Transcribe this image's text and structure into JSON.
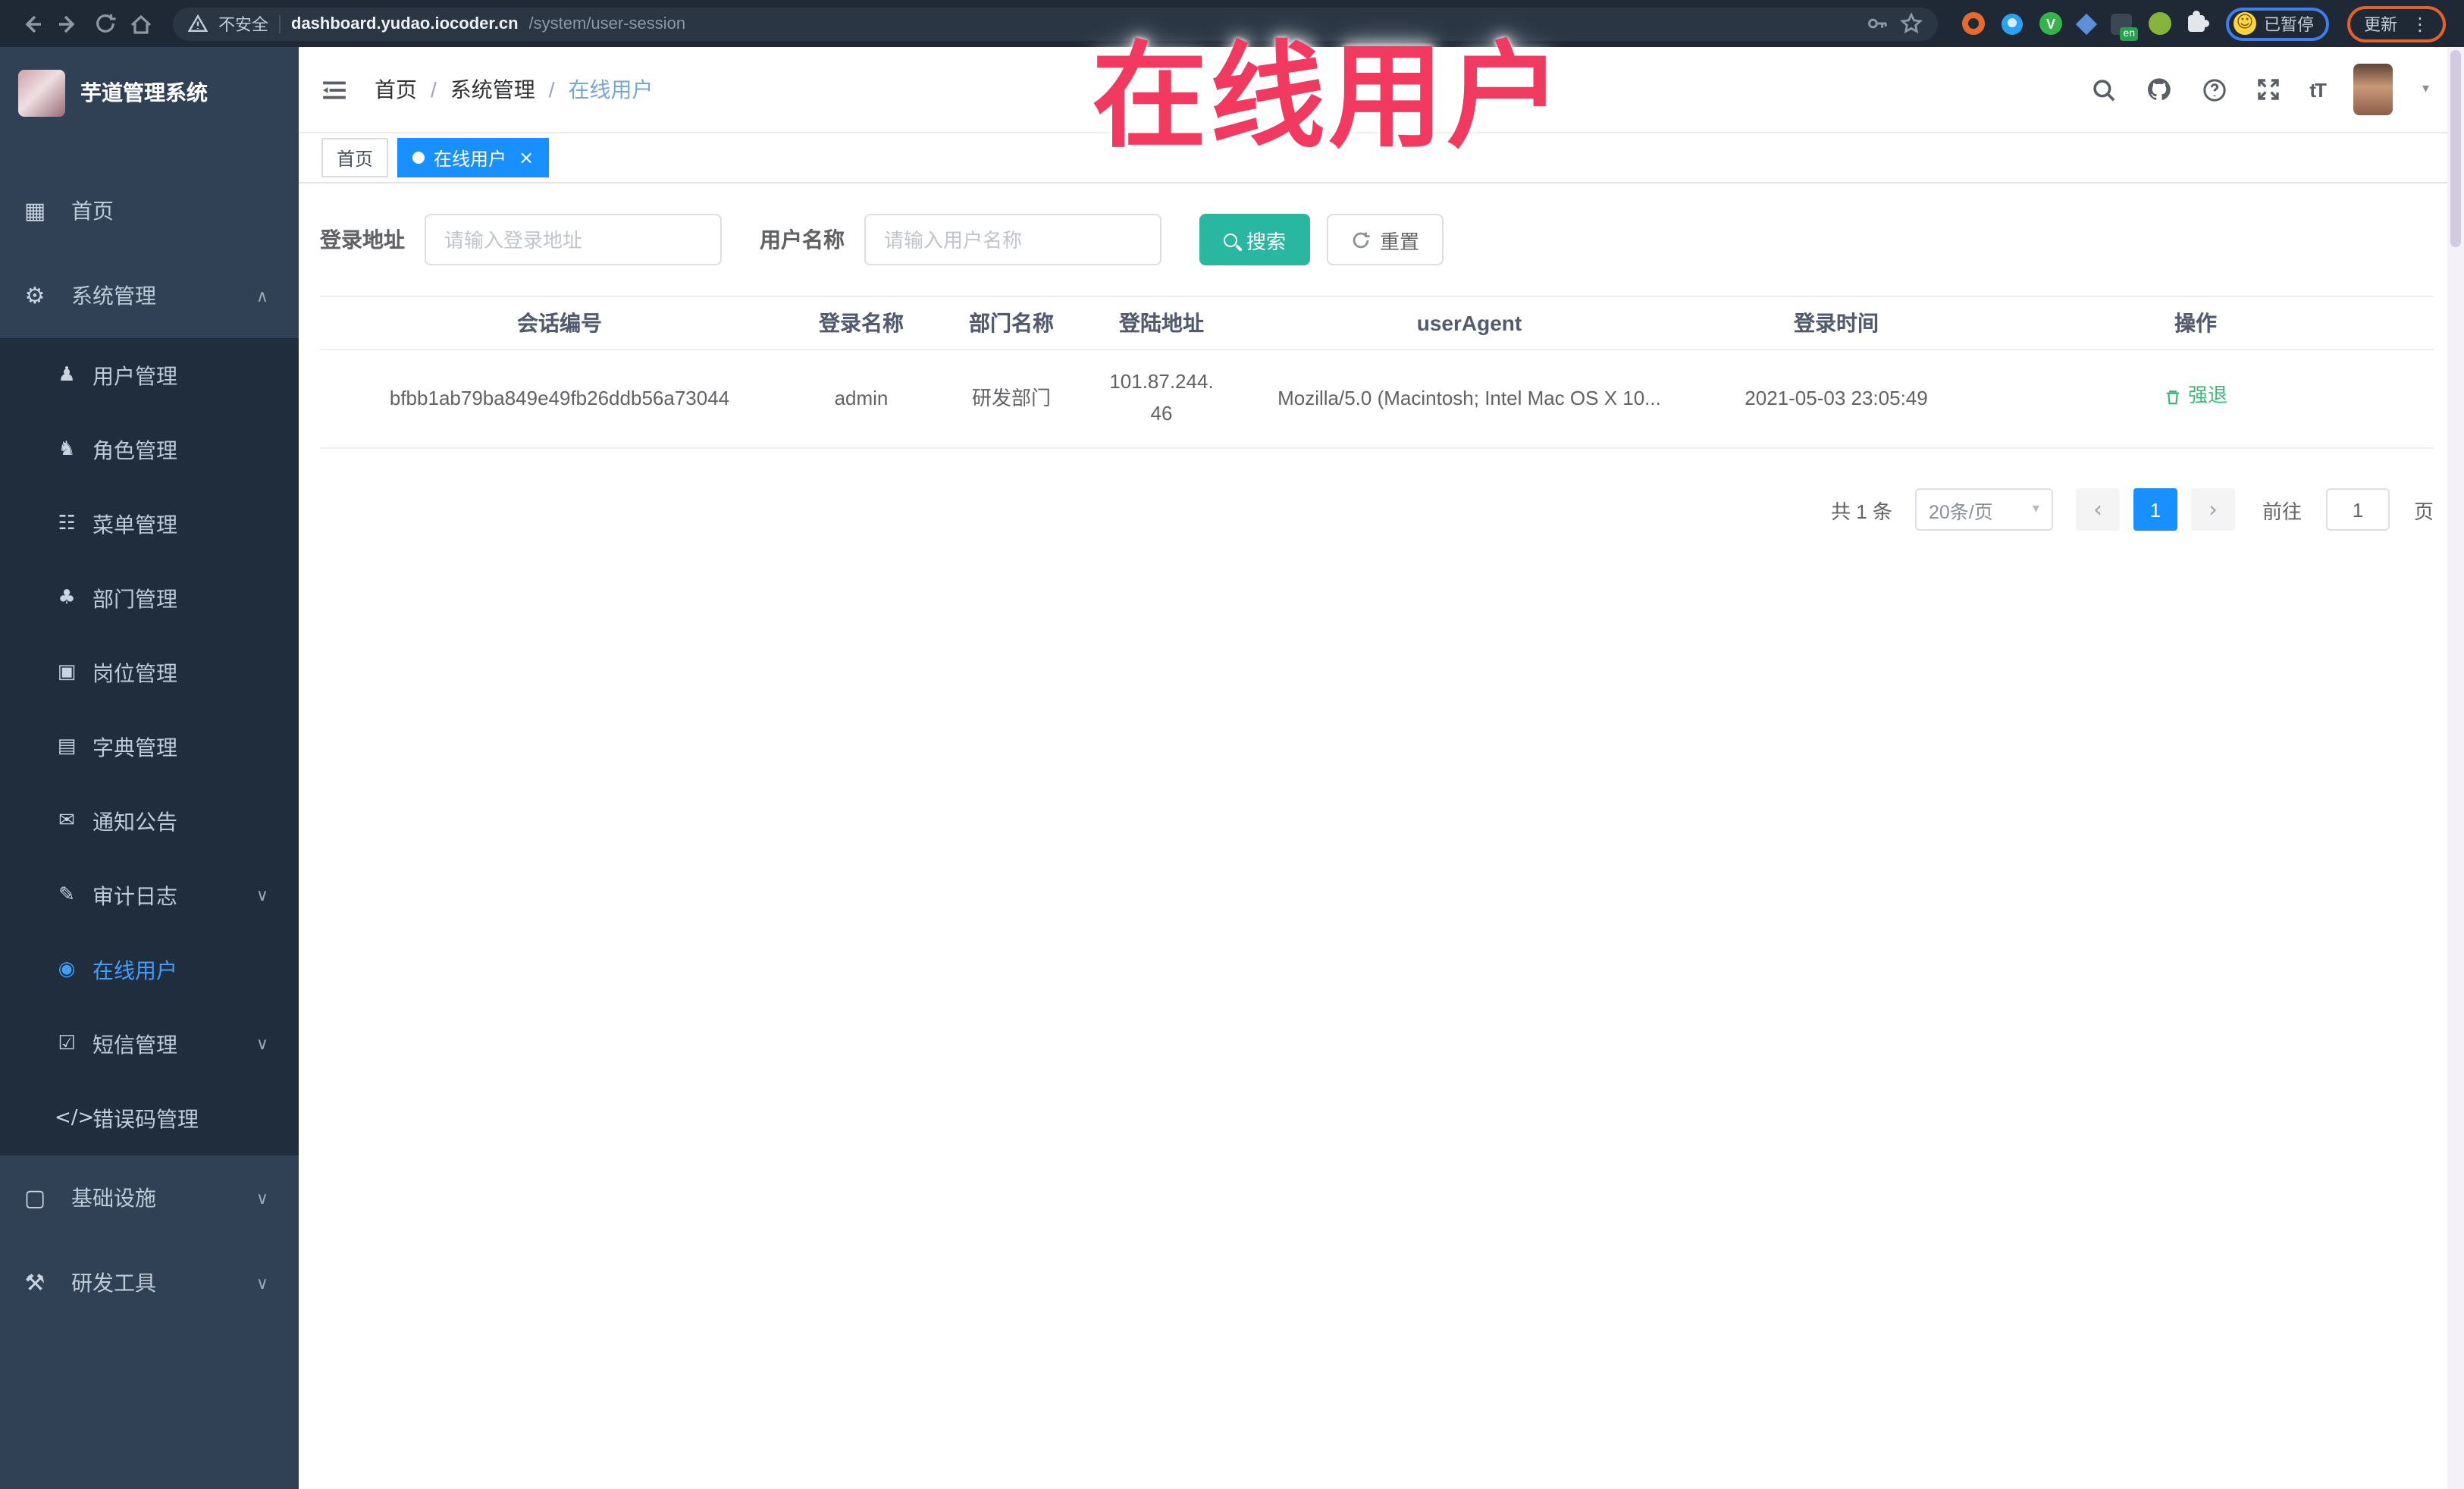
{
  "browser": {
    "security_label": "不安全",
    "url_domain": "dashboard.yudao.iocoder.cn",
    "url_path": "/system/user-session",
    "extension_v_letter": "V",
    "extension_en_badge": "en",
    "paused_label": "已暂停",
    "update_label": "更新"
  },
  "overlay": {
    "title": "在线用户"
  },
  "icons": {
    "kebab": "⋮",
    "caret_down": "▾",
    "face": "☺",
    "font_size": "tT",
    "tag_close": "×",
    "page_prev": "‹",
    "page_next": "›"
  },
  "sidebar": {
    "logo_title": "芋道管理系统",
    "items": [
      {
        "label": "首页",
        "icon": "▦"
      },
      {
        "label": "系统管理",
        "icon": "⚙",
        "arrow": "∧"
      },
      {
        "label": "用户管理",
        "icon": "♟"
      },
      {
        "label": "角色管理",
        "icon": "♞"
      },
      {
        "label": "菜单管理",
        "icon": "☷"
      },
      {
        "label": "部门管理",
        "icon": "♣"
      },
      {
        "label": "岗位管理",
        "icon": "▣"
      },
      {
        "label": "字典管理",
        "icon": "▤"
      },
      {
        "label": "通知公告",
        "icon": "✉"
      },
      {
        "label": "审计日志",
        "icon": "✎",
        "arrow": "∨"
      },
      {
        "label": "在线用户",
        "icon": "◉",
        "active": true
      },
      {
        "label": "短信管理",
        "icon": "☑",
        "arrow": "∨"
      },
      {
        "label": "错误码管理",
        "icon": "</>"
      },
      {
        "label": "基础设施",
        "icon": "▢",
        "arrow": "∨"
      },
      {
        "label": "研发工具",
        "icon": "⚒",
        "arrow": "∨"
      }
    ]
  },
  "navbar": {
    "breadcrumb": [
      "首页",
      "系统管理",
      "在线用户"
    ],
    "separator": "/"
  },
  "tags": [
    {
      "label": "首页"
    },
    {
      "label": "在线用户"
    }
  ],
  "filters": {
    "address_label": "登录地址",
    "address_placeholder": "请输入登录地址",
    "username_label": "用户名称",
    "username_placeholder": "请输入用户名称",
    "search_label": "搜索",
    "reset_label": "重置"
  },
  "table": {
    "headers": [
      "会话编号",
      "登录名称",
      "部门名称",
      "登陆地址",
      "userAgent",
      "登录时间",
      "操作"
    ],
    "rows": [
      {
        "session_id": "bfbb1ab79ba849e49fb26ddb56a73044",
        "username": "admin",
        "dept": "研发部门",
        "ip": "101.87.244.46",
        "user_agent": "Mozilla/5.0 (Macintosh; Intel Mac OS X 10...",
        "login_time": "2021-05-03 23:05:49",
        "action": "强退"
      }
    ]
  },
  "pagination": {
    "total": "共 1 条",
    "page_size": "20条/页",
    "current_page": "1",
    "goto_label": "前往",
    "goto_value": "1",
    "goto_unit": "页"
  },
  "colors": {
    "accent_blue": "#1890ff",
    "menu_active_blue": "#409eff",
    "search_teal": "#2ab7a2",
    "action_green": "#3db87a",
    "overlay_red": "#f2395f",
    "sidebar_bg": "#304156",
    "submenu_bg": "#1f2d3d"
  }
}
